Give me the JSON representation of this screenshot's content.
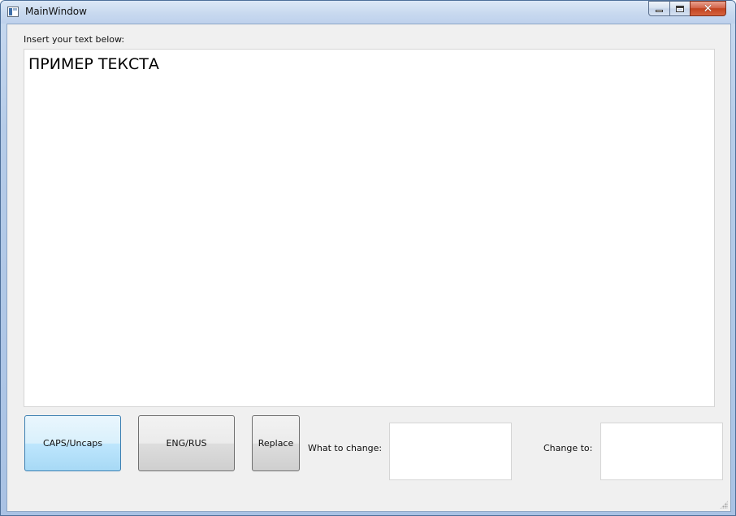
{
  "window": {
    "title": "MainWindow"
  },
  "editor": {
    "label": "Insert your text below:",
    "value": "ПРИМЕР ТЕКСТА"
  },
  "buttons": {
    "caps": "CAPS/Uncaps",
    "lang": "ENG/RUS",
    "replace": "Replace"
  },
  "replace_fields": {
    "what_label": "What to change:",
    "what_value": "",
    "to_label": "Change to:",
    "to_value": ""
  },
  "colors": {
    "accent_hover": "#bee6fd",
    "titlebar": "#c8d9ef",
    "close_button": "#c2431f"
  },
  "icons": {
    "app": "app-window-icon",
    "minimize": "minimize-icon",
    "maximize": "maximize-icon",
    "close": "close-icon"
  }
}
